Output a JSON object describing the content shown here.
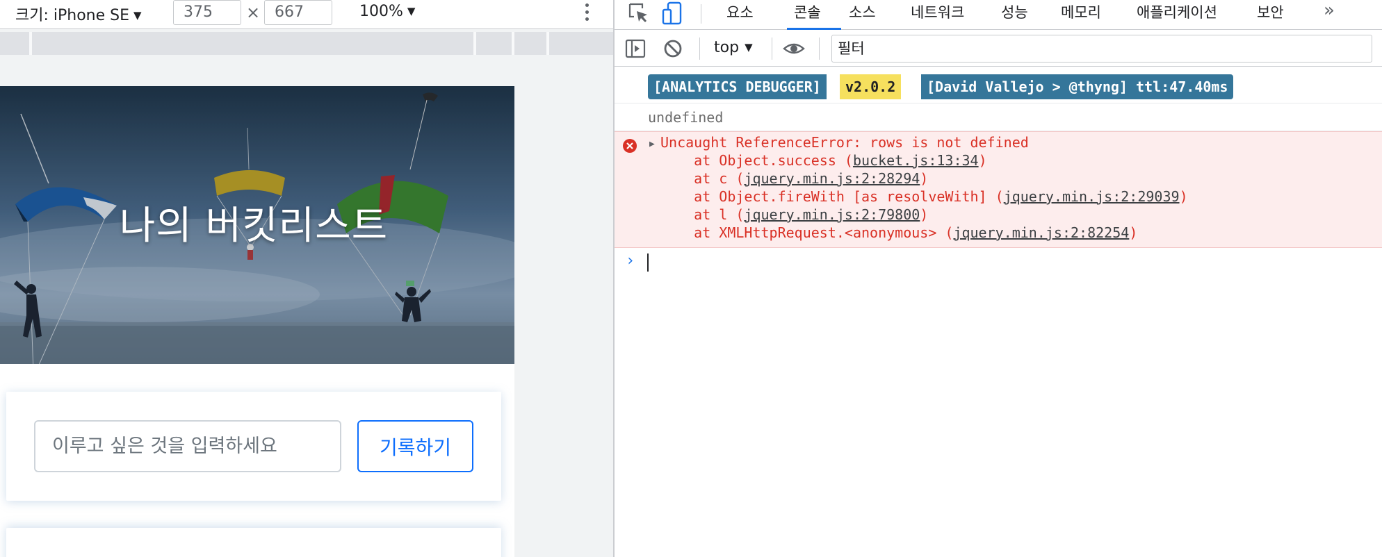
{
  "device_toolbar": {
    "device_label": "크기: iPhone SE",
    "width_value": "375",
    "height_value": "667",
    "times_symbol": "×",
    "zoom_label": "100%"
  },
  "page": {
    "hero_title": "나의 버킷리스트",
    "input_placeholder": "이루고 싶은 것을 입력하세요",
    "save_button_label": "기록하기"
  },
  "devtools": {
    "tabs": [
      "요소",
      "콘솔",
      "소스",
      "네트워크",
      "성능",
      "메모리",
      "애플리케이션",
      "보안"
    ],
    "active_tab": "콘솔",
    "more_tabs": "»",
    "console_context": "top",
    "filter_value": "필터"
  },
  "console": {
    "badge_name": "[ANALYTICS DEBUGGER]",
    "badge_version": "v2.0.2",
    "badge_author": "[David Vallejo > @thyng] ttl:47.40ms",
    "undefined_value": "undefined",
    "error_message": "Uncaught ReferenceError: rows is not defined",
    "stack": [
      {
        "prefix": "    at Object.success (",
        "link": "bucket.js:13:34",
        "suffix": ")"
      },
      {
        "prefix": "    at c (",
        "link": "jquery.min.js:2:28294",
        "suffix": ")"
      },
      {
        "prefix": "    at Object.fireWith [as resolveWith] (",
        "link": "jquery.min.js:2:29039",
        "suffix": ")"
      },
      {
        "prefix": "    at l (",
        "link": "jquery.min.js:2:79800",
        "suffix": ")"
      },
      {
        "prefix": "    at XMLHttpRequest.<anonymous> (",
        "link": "jquery.min.js:2:82254",
        "suffix": ")"
      }
    ],
    "prompt_symbol": "›"
  },
  "colors": {
    "accent": "#1a73e8",
    "button_blue": "#0d6efd",
    "error_red": "#d93025",
    "error_bg": "#fdeded",
    "badge_blue": "#35769a",
    "badge_yellow": "#f6e05e"
  },
  "icons": [
    "inspect-element-icon",
    "device-toggle-icon",
    "sidebar-toggle-icon",
    "clear-console-icon",
    "eye-icon",
    "error-icon",
    "kebab-menu-icon"
  ]
}
